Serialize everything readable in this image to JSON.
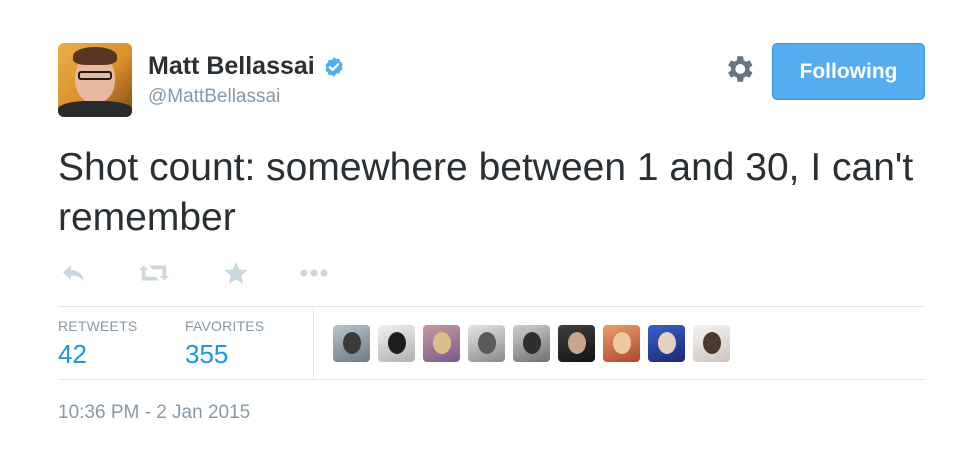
{
  "header": {
    "display_name": "Matt Bellassai",
    "handle": "@MattBellassai",
    "verified": true,
    "verified_icon": "verified-badge-icon",
    "settings_icon": "gear-icon",
    "follow_button_label": "Following"
  },
  "tweet": {
    "text": "Shot count: somewhere between 1 and 30, I can't remember"
  },
  "actions": [
    {
      "name": "reply",
      "icon": "reply-icon"
    },
    {
      "name": "retweet",
      "icon": "retweet-icon"
    },
    {
      "name": "favorite",
      "icon": "star-icon"
    },
    {
      "name": "more",
      "icon": "more-dots-icon"
    }
  ],
  "stats": {
    "retweets_label": "RETWEETS",
    "retweets_count": "42",
    "favorites_label": "FAVORITES",
    "favorites_count": "355"
  },
  "favoriters_count_shown": 9,
  "timestamp": "10:36 PM - 2 Jan 2015",
  "colors": {
    "accent": "#55acee",
    "count_blue": "#1b95e0",
    "muted_text": "#8899a6",
    "body_text": "#292f33"
  }
}
